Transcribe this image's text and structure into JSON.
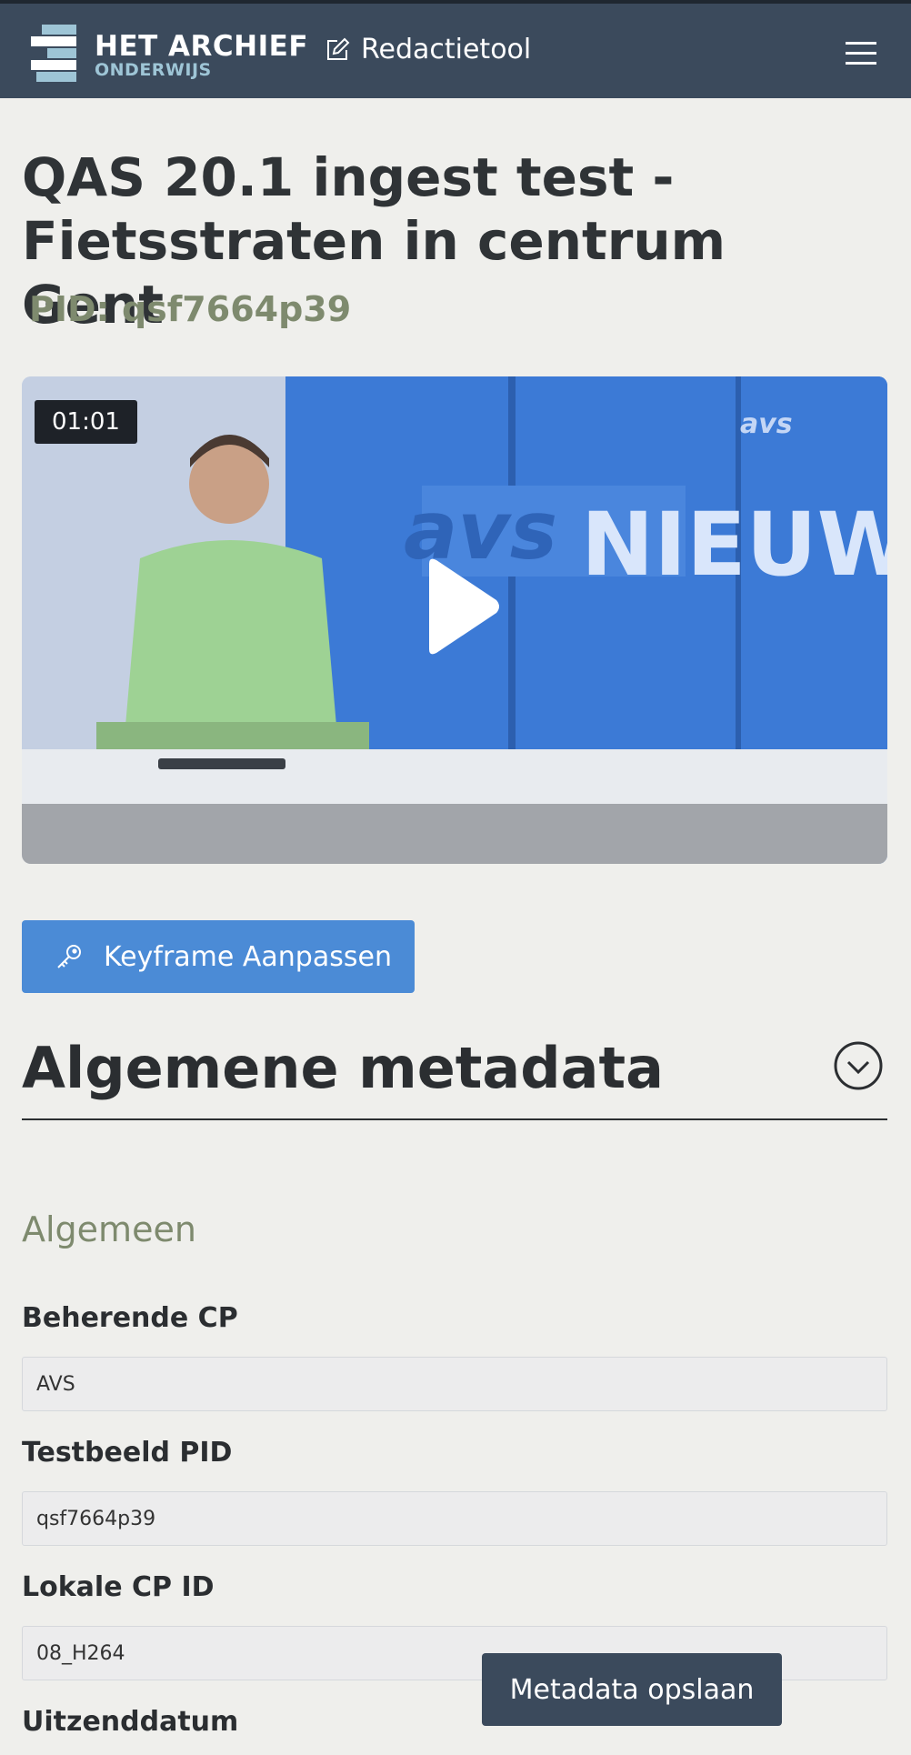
{
  "header": {
    "brand_line1": "HET ARCHIEF",
    "brand_line2": "ONDERWIJS",
    "nav_edit_label": "Redactietool"
  },
  "page": {
    "title": "QAS 20.1 ingest test - Fietsstraten in centrum Gent",
    "pid": "PID: qsf7664p39"
  },
  "video": {
    "duration": "01:01",
    "channel_logo": "avs",
    "banner_text": "NIEUWS"
  },
  "actions": {
    "keyframe_label": "Keyframe Aanpassen",
    "save_label": "Metadata opslaan"
  },
  "metadata": {
    "section_title": "Algemene metadata",
    "subsection_title": "Algemeen",
    "fields": [
      {
        "label": "Beherende CP",
        "value": "AVS"
      },
      {
        "label": "Testbeeld PID",
        "value": "qsf7664p39"
      },
      {
        "label": "Lokale CP ID",
        "value": "08_H264"
      },
      {
        "label": "Uitzenddatum",
        "value": ""
      }
    ]
  },
  "colors": {
    "header_bg": "#3b4a5c",
    "accent_blue": "#4b8bd6",
    "muted_green": "#7e8a6e",
    "page_bg": "#efefec"
  },
  "icons": [
    "hamburger-menu-icon",
    "edit-icon",
    "play-icon",
    "key-icon",
    "chevron-down-circle-icon"
  ]
}
